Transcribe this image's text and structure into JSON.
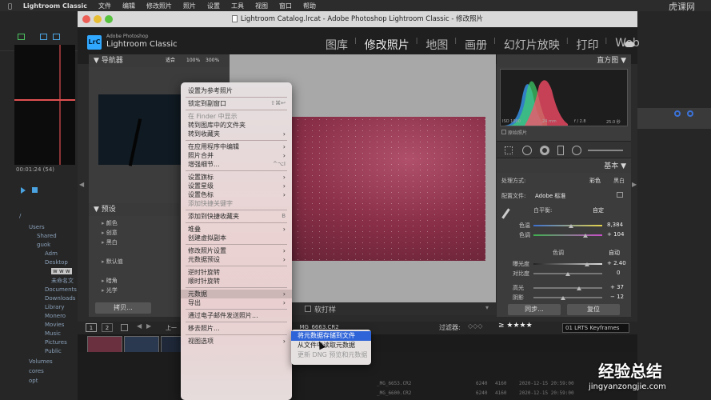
{
  "menubar": {
    "apple": "",
    "app": "Lightroom Classic",
    "items": [
      "文件",
      "编辑",
      "修改照片",
      "照片",
      "设置",
      "工具",
      "视图",
      "窗口",
      "帮助"
    ]
  },
  "window": {
    "title": "Lightroom Catalog.lrcat - Adobe Photoshop Lightroom Classic - 修改照片"
  },
  "identity": {
    "badge": "LrC",
    "line1": "Adobe Photoshop",
    "line2": "Lightroom Classic"
  },
  "modules": [
    "图库",
    "修改照片",
    "地图",
    "画册",
    "幻灯片放映",
    "打印",
    "Web"
  ],
  "active_module": 1,
  "navigator": {
    "title": "导航器",
    "fit": "适合",
    "z1": "100%",
    "z2": "300%"
  },
  "presets": {
    "title": "预设",
    "items": [
      "颜色",
      "创意",
      "黑白",
      "默认值",
      "暗角",
      "光学"
    ]
  },
  "left_buttons": {
    "copy": "拷贝..."
  },
  "toolbar": {
    "softproof": "软打样"
  },
  "histogram": {
    "title": "直方图",
    "iso": "ISO 1000",
    "focal": "24 mm",
    "aperture": "f / 2.8",
    "shutter": "25.0 秒",
    "original": "原始照片"
  },
  "basic": {
    "title": "基本",
    "treatment_label": "处理方式:",
    "color": "彩色",
    "bw": "黑白",
    "profile_label": "配置文件:",
    "profile_value": "Adobe 标准",
    "wb_label": "白平衡:",
    "wb_value": "自定",
    "temp_label": "色温",
    "temp_value": "8,384",
    "tint_label": "色调",
    "tint_value": "+ 104",
    "tone_label": "色调",
    "auto": "自动",
    "exposure_label": "曝光度",
    "exposure_value": "+ 2.40",
    "contrast_label": "对比度",
    "contrast_value": "0",
    "highlights_label": "高光",
    "highlights_value": "+ 37",
    "shadows_label": "阴影",
    "shadows_value": "− 12"
  },
  "right_buttons": {
    "sync": "同步...",
    "reset": "复位"
  },
  "filmstrip": {
    "filter_label": "过滤器:",
    "collection": "01 LRTS Keyframes",
    "page1": "1",
    "page2": "2",
    "prev": "上一",
    "filename": "_MG_6663.CR2"
  },
  "folders": [
    "/",
    "Users",
    "Shared",
    "guok",
    "Adm",
    "Desktop",
    "w w w",
    "未命名文",
    "Documents",
    "Downloads",
    "Library",
    "Monero",
    "Movies",
    "Music",
    "Pictures",
    "Public",
    "Volumes",
    "cores",
    "opt"
  ],
  "timecode": "00:01:24 (54)",
  "context_menu": [
    {
      "label": "设置为参考照片"
    },
    {
      "sep": true
    },
    {
      "label": "锁定到副窗口",
      "shortcut": "⇧⌘↩"
    },
    {
      "sep": true
    },
    {
      "label": "在 Finder 中显示",
      "disabled": true
    },
    {
      "label": "转到图库中的文件夹"
    },
    {
      "label": "转到收藏夹",
      "submenu": true
    },
    {
      "sep": true
    },
    {
      "label": "在应用程序中编辑",
      "submenu": true
    },
    {
      "label": "照片合并",
      "submenu": true
    },
    {
      "label": "增强细节...",
      "shortcut": "^⌥I"
    },
    {
      "sep": true
    },
    {
      "label": "设置旗标",
      "submenu": true
    },
    {
      "label": "设置星级",
      "submenu": true
    },
    {
      "label": "设置色标",
      "submenu": true
    },
    {
      "label": "添加快捷关键字",
      "disabled": true
    },
    {
      "sep": true
    },
    {
      "label": "添加到快捷收藏夹",
      "shortcut": "B"
    },
    {
      "sep": true
    },
    {
      "label": "堆叠",
      "submenu": true
    },
    {
      "label": "创建虚拟副本"
    },
    {
      "sep": true
    },
    {
      "label": "修改照片设置",
      "submenu": true
    },
    {
      "label": "元数据预设",
      "submenu": true
    },
    {
      "sep": true
    },
    {
      "label": "逆时针旋转"
    },
    {
      "label": "顺时针旋转"
    },
    {
      "sep": true
    },
    {
      "label": "元数据",
      "submenu": true,
      "highlighted": true
    },
    {
      "label": "导出",
      "submenu": true
    },
    {
      "sep": true
    },
    {
      "label": "通过电子邮件发送照片..."
    },
    {
      "sep": true
    },
    {
      "label": "移去照片..."
    },
    {
      "sep": true
    },
    {
      "label": "视图选项",
      "submenu": true
    }
  ],
  "submenu": [
    {
      "label": "将元数据存储到文件",
      "highlighted": true
    },
    {
      "label": "从文件中读取元数据"
    },
    {
      "label": "更新 DNG 预览和元数据",
      "disabled": true
    }
  ],
  "file_rows": [
    {
      "name": "_MG_6653.CR2",
      "w": "6240",
      "h": "4160",
      "date": "2020-12-15 20:59:00"
    },
    {
      "name": "_MG_6600.CR2",
      "w": "6240",
      "h": "4160",
      "date": "2020-12-15 20:59:00"
    }
  ],
  "watermarks": {
    "top": "虎课网",
    "bottom_big": "经验总结",
    "bottom_url": "jingyanzongjie.com"
  },
  "colors": {
    "accent": "#3b73d9",
    "menu_highlight": "#2f64d8",
    "photo_sky": "#8a2f48"
  }
}
